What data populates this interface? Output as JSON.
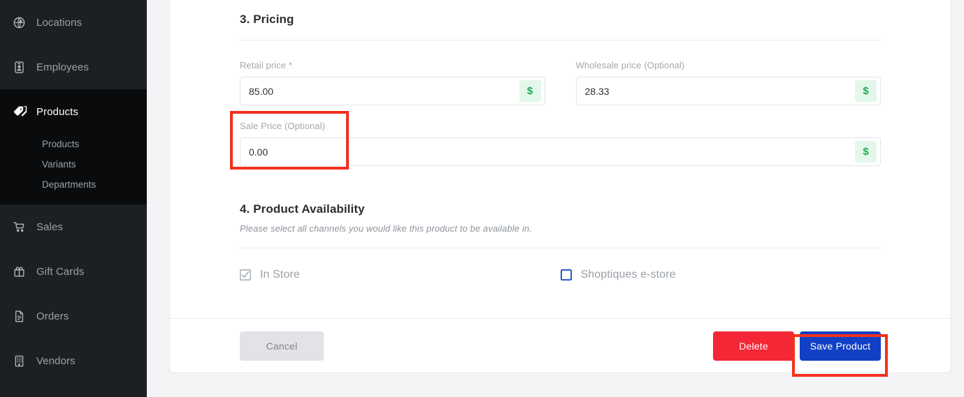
{
  "sidebar": {
    "items": [
      {
        "id": "locations",
        "label": "Locations",
        "icon": "globe-icon",
        "active": false
      },
      {
        "id": "employees",
        "label": "Employees",
        "icon": "id-badge-icon",
        "active": false
      },
      {
        "id": "products",
        "label": "Products",
        "icon": "price-tag-icon",
        "active": true
      },
      {
        "id": "sales",
        "label": "Sales",
        "icon": "shopping-cart-icon",
        "active": false
      },
      {
        "id": "giftcards",
        "label": "Gift Cards",
        "icon": "gift-icon",
        "active": false
      },
      {
        "id": "orders",
        "label": "Orders",
        "icon": "document-icon",
        "active": false
      },
      {
        "id": "vendors",
        "label": "Vendors",
        "icon": "building-icon",
        "active": false
      }
    ],
    "sub_items": [
      {
        "id": "products-sub",
        "label": "Products"
      },
      {
        "id": "variants",
        "label": "Variants"
      },
      {
        "id": "departments",
        "label": "Departments"
      }
    ]
  },
  "pricing": {
    "title": "3. Pricing",
    "retail": {
      "label": "Retail price *",
      "value": "85.00",
      "suffix": "$"
    },
    "wholesale": {
      "label": "Wholesale price (Optional)",
      "value": "28.33",
      "suffix": "$"
    },
    "sale": {
      "label": "Sale Price (Optional)",
      "value": "0.00",
      "suffix": "$"
    }
  },
  "availability": {
    "title": "4. Product Availability",
    "description": "Please select all channels you would like this product to be available in.",
    "channels": [
      {
        "id": "in-store",
        "label": "In Store",
        "checked": true,
        "style": "gray"
      },
      {
        "id": "e-store",
        "label": "Shoptiques e-store",
        "checked": false,
        "style": "blue"
      }
    ]
  },
  "footer": {
    "cancel_label": "Cancel",
    "delete_label": "Delete",
    "save_label": "Save Product"
  },
  "colors": {
    "accent_blue": "#1240c4",
    "danger_red": "#f32735",
    "annotation_red": "#f3301d",
    "suffix_green": "#22aa55",
    "sidebar_bg": "#1c2024",
    "sidebar_active_bg": "#0a0b0d"
  }
}
